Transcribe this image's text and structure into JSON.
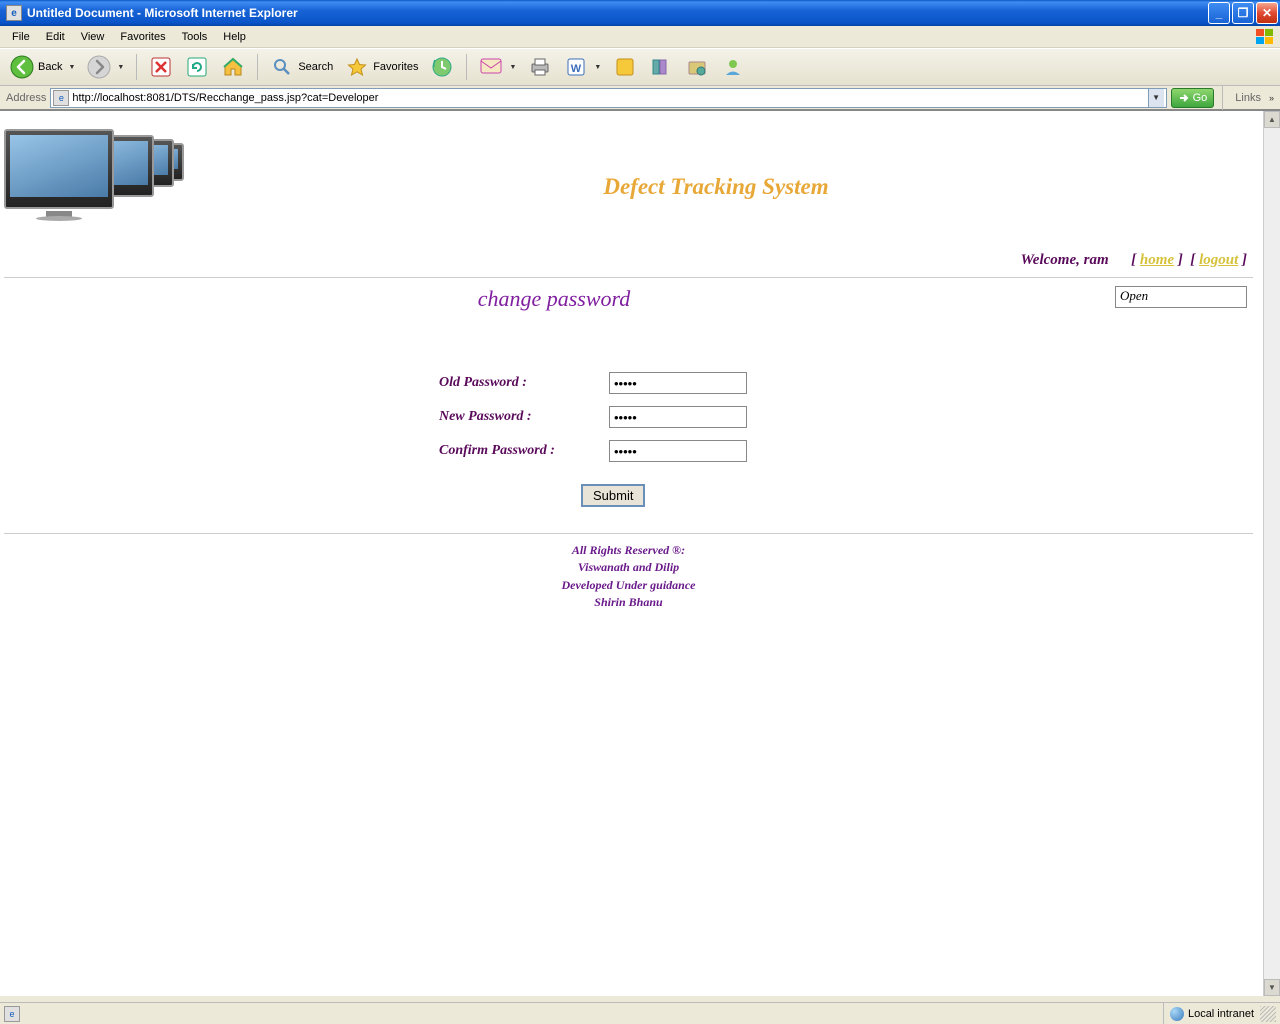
{
  "window": {
    "title": "Untitled Document - Microsoft Internet Explorer"
  },
  "menubar": {
    "items": [
      "File",
      "Edit",
      "View",
      "Favorites",
      "Tools",
      "Help"
    ]
  },
  "toolbar": {
    "back": "Back",
    "search": "Search",
    "favorites": "Favorites"
  },
  "addressbar": {
    "label": "Address",
    "url": "http://localhost:8081/DTS/Recchange_pass.jsp?cat=Developer",
    "go": "Go",
    "links": "Links"
  },
  "page": {
    "app_title": "Defect Tracking System",
    "welcome_prefix": "Welcome,  ",
    "welcome_user": "ram",
    "home_link": "home",
    "logout_link": "logout",
    "dropdown_value": "Open",
    "section_title": "change password",
    "form": {
      "old_label": "Old Password :",
      "new_label": "New Password :",
      "confirm_label": "Confirm Password :",
      "old_value": "•••••",
      "new_value": "•••••",
      "confirm_value": "•••••",
      "submit": "Submit"
    },
    "footer": {
      "line1": "All Rights Reserved ®:",
      "line2": "Viswanath and Dilip",
      "line3": "Developed Under guidance",
      "line4": "Shirin Bhanu"
    }
  },
  "statusbar": {
    "zone": "Local intranet"
  }
}
